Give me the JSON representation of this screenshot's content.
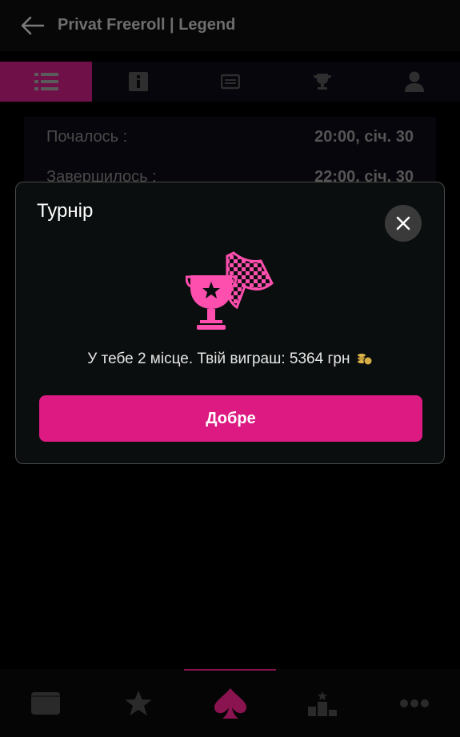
{
  "header": {
    "back_icon": "arrow-left-icon",
    "title": "Privat Freeroll | Legend"
  },
  "tabs": [
    {
      "icon": "list-icon",
      "active": true
    },
    {
      "icon": "info-icon",
      "active": false
    },
    {
      "icon": "ticket-icon",
      "active": false
    },
    {
      "icon": "trophy-icon",
      "active": false
    },
    {
      "icon": "user-icon",
      "active": false
    }
  ],
  "info": {
    "rows": [
      {
        "label": "Почалось :",
        "value": "20:00, січ. 30"
      },
      {
        "label": "Завершилось :",
        "value": "22:00, січ. 30"
      }
    ]
  },
  "modal": {
    "title": "Турнір",
    "close_icon": "close-icon",
    "illustration": "trophy-flag-icon",
    "message": "У тебе 2 місце. Твій виграш: 5364 грн",
    "currency_icon": "coin-stack-icon",
    "ok_label": "Добре"
  },
  "bottom_nav": [
    {
      "icon": "wallet-icon",
      "active": false
    },
    {
      "icon": "star-icon",
      "active": false
    },
    {
      "icon": "spade-icon",
      "active": true
    },
    {
      "icon": "podium-icon",
      "active": false
    },
    {
      "icon": "more-icon",
      "active": false
    }
  ],
  "colors": {
    "accent": "#dc1a82",
    "accent_dim": "#701049",
    "background": "#000000",
    "modal_bg": "#0b0e0e"
  }
}
